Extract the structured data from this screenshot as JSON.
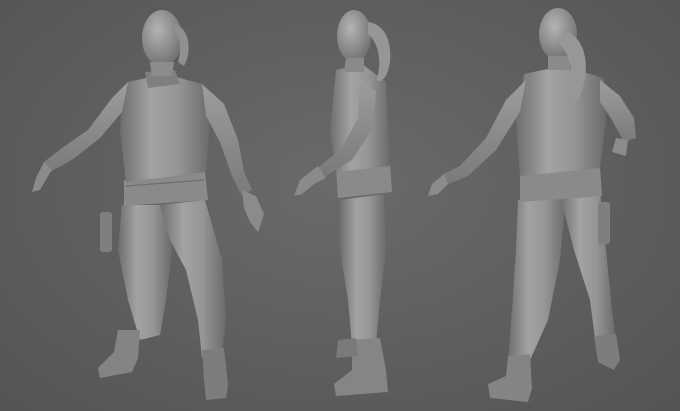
{
  "scene": {
    "background_color": "#5f5f5f",
    "model_material_color": "#8c8c8c",
    "views": [
      {
        "id": "front-three-quarter"
      },
      {
        "id": "side"
      },
      {
        "id": "back-three-quarter"
      }
    ]
  }
}
